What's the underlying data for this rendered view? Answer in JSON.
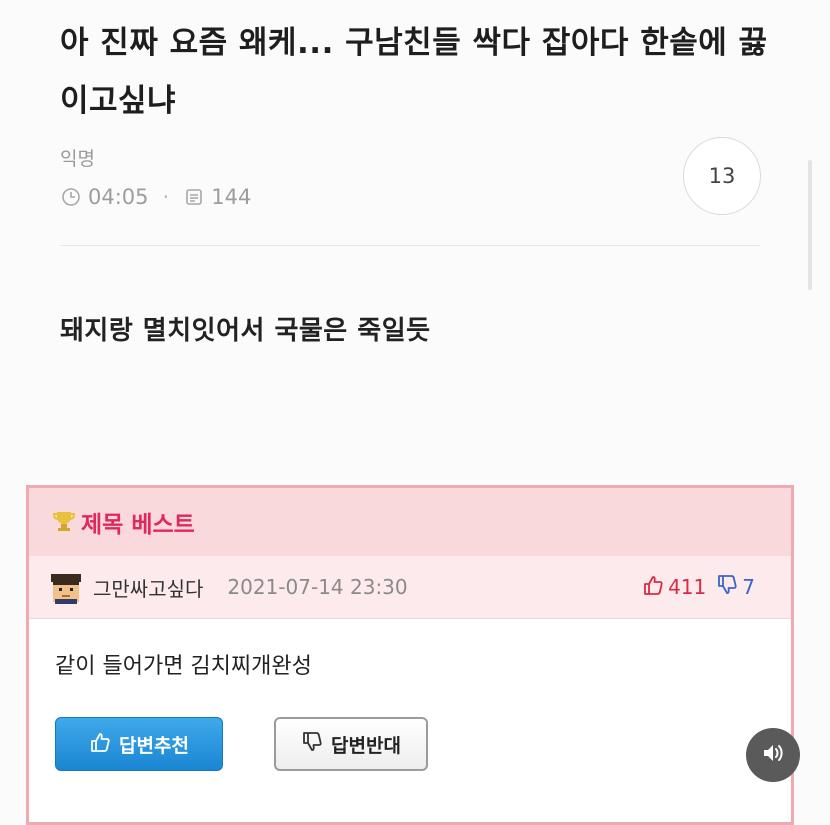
{
  "post": {
    "title": "아 진짜 요즘 왜케... 구남친들 싹다 잡아다 한솥에 끓이고싶냐",
    "author": "익명",
    "time": "04:05",
    "views": "144",
    "comment_count": "13",
    "body": "돼지랑 멸치잇어서 국물은 죽일듯"
  },
  "best": {
    "header": "제목 베스트",
    "answer": {
      "nickname": "그만싸고싶다",
      "date": "2021-07-14 23:30",
      "likes": "411",
      "dislikes": "7",
      "text": "같이 들어가면 김치찌개완성"
    },
    "recommend_label": "답변추천",
    "oppose_label": "답변반대"
  },
  "colors": {
    "accent_pink": "#e0285a",
    "button_blue": "#1a86d2"
  },
  "icons": {
    "clock": "clock-icon",
    "views": "views-icon",
    "sound": "speaker-icon"
  }
}
